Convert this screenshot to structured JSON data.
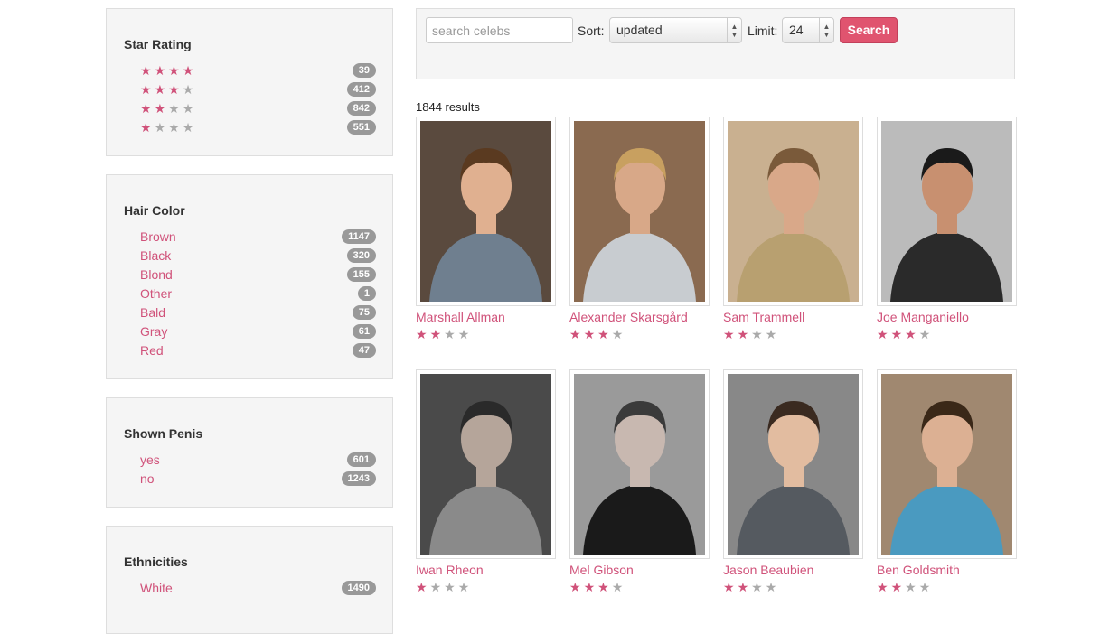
{
  "filters": {
    "star_rating": {
      "title": "Star Rating",
      "items": [
        {
          "rating": 4,
          "count": "39"
        },
        {
          "rating": 3,
          "count": "412"
        },
        {
          "rating": 2,
          "count": "842"
        },
        {
          "rating": 1,
          "count": "551"
        }
      ]
    },
    "hair_color": {
      "title": "Hair Color",
      "items": [
        {
          "label": "Brown",
          "count": "1147"
        },
        {
          "label": "Black",
          "count": "320"
        },
        {
          "label": "Blond",
          "count": "155"
        },
        {
          "label": "Other",
          "count": "1"
        },
        {
          "label": "Bald",
          "count": "75"
        },
        {
          "label": "Gray",
          "count": "61"
        },
        {
          "label": "Red",
          "count": "47"
        }
      ]
    },
    "shown_penis": {
      "title": "Shown Penis",
      "items": [
        {
          "label": "yes",
          "count": "601"
        },
        {
          "label": "no",
          "count": "1243"
        }
      ]
    },
    "ethnicities": {
      "title": "Ethnicities",
      "items": [
        {
          "label": "White",
          "count": "1490"
        }
      ]
    }
  },
  "search": {
    "placeholder": "search celebs",
    "sort_label": "Sort:",
    "sort_value": "updated",
    "limit_label": "Limit:",
    "limit_value": "24",
    "button_label": "Search"
  },
  "results_count": "1844 results",
  "celebs": [
    {
      "name": "Marshall Allman",
      "rating": 2
    },
    {
      "name": "Alexander Skarsgård",
      "rating": 3
    },
    {
      "name": "Sam Trammell",
      "rating": 2
    },
    {
      "name": "Joe Manganiello",
      "rating": 3
    },
    {
      "name": "Iwan Rheon",
      "rating": 1
    },
    {
      "name": "Mel Gibson",
      "rating": 3
    },
    {
      "name": "Jason Beaubien",
      "rating": 2
    },
    {
      "name": "Ben Goldsmith",
      "rating": 2
    }
  ],
  "colors": {
    "accent": "#d0527a",
    "button": "#e0546f",
    "badge": "#999999"
  }
}
